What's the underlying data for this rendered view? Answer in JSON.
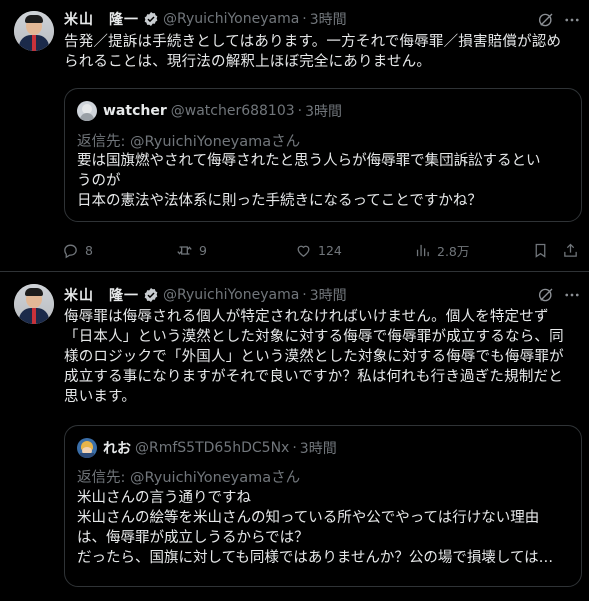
{
  "tweets": [
    {
      "author_name": "米山　隆一",
      "handle": "@RyuichiYoneyama",
      "time": "3時間",
      "text_lines": [
        "告発／提訴は手続きとしてはあります。一方それで侮辱罪／損害賠償が認め",
        "られることは、現行法の解釈上ほぼ完全にありません。"
      ],
      "quote": {
        "author_name": "watcher",
        "handle": "@watcher688103",
        "time": "3時間",
        "reply_to": "返信先: @RyuichiYoneyamaさん",
        "text_lines": [
          "要は国旗燃やされて侮辱されたと思う人らが侮辱罪で集団訴訟するとい",
          "うのが",
          "日本の憲法や法体系に則った手続きになるってことですかね？"
        ]
      },
      "actions": {
        "replies": "8",
        "retweets": "9",
        "likes": "124",
        "views": "2.8万"
      }
    },
    {
      "author_name": "米山　隆一",
      "handle": "@RyuichiYoneyama",
      "time": "3時間",
      "text_lines": [
        "侮辱罪は侮辱される個人が特定されなければいけません。個人を特定せず",
        "「日本人」という漠然とした対象に対する侮辱で侮辱罪が成立するなら、同",
        "様のロジックで「外国人」という漠然とした対象に対する侮辱でも侮辱罪が",
        "成立する事になりますがそれで良いですか？私は何れも行き過ぎた規制だと",
        "思います。"
      ],
      "quote": {
        "author_name": "れお",
        "handle": "@RmfS5TD65hDC5Nx",
        "time": "3時間",
        "reply_to": "返信先: @RyuichiYoneyamaさん",
        "text_lines": [
          "米山さんの言う通りですね",
          "米山さんの絵等を米山さんの知っている所や公でやっては行けない理由",
          "は、侮辱罪が成立しうるからでは？",
          "だったら、国旗に対しても同様ではありませんか？公の場で損壊しては…"
        ]
      }
    }
  ],
  "colors": {
    "background": "#000000",
    "text": "#e7e9ea",
    "muted": "#71767b",
    "border": "#2f3336",
    "verified": "#1d9bf0"
  }
}
